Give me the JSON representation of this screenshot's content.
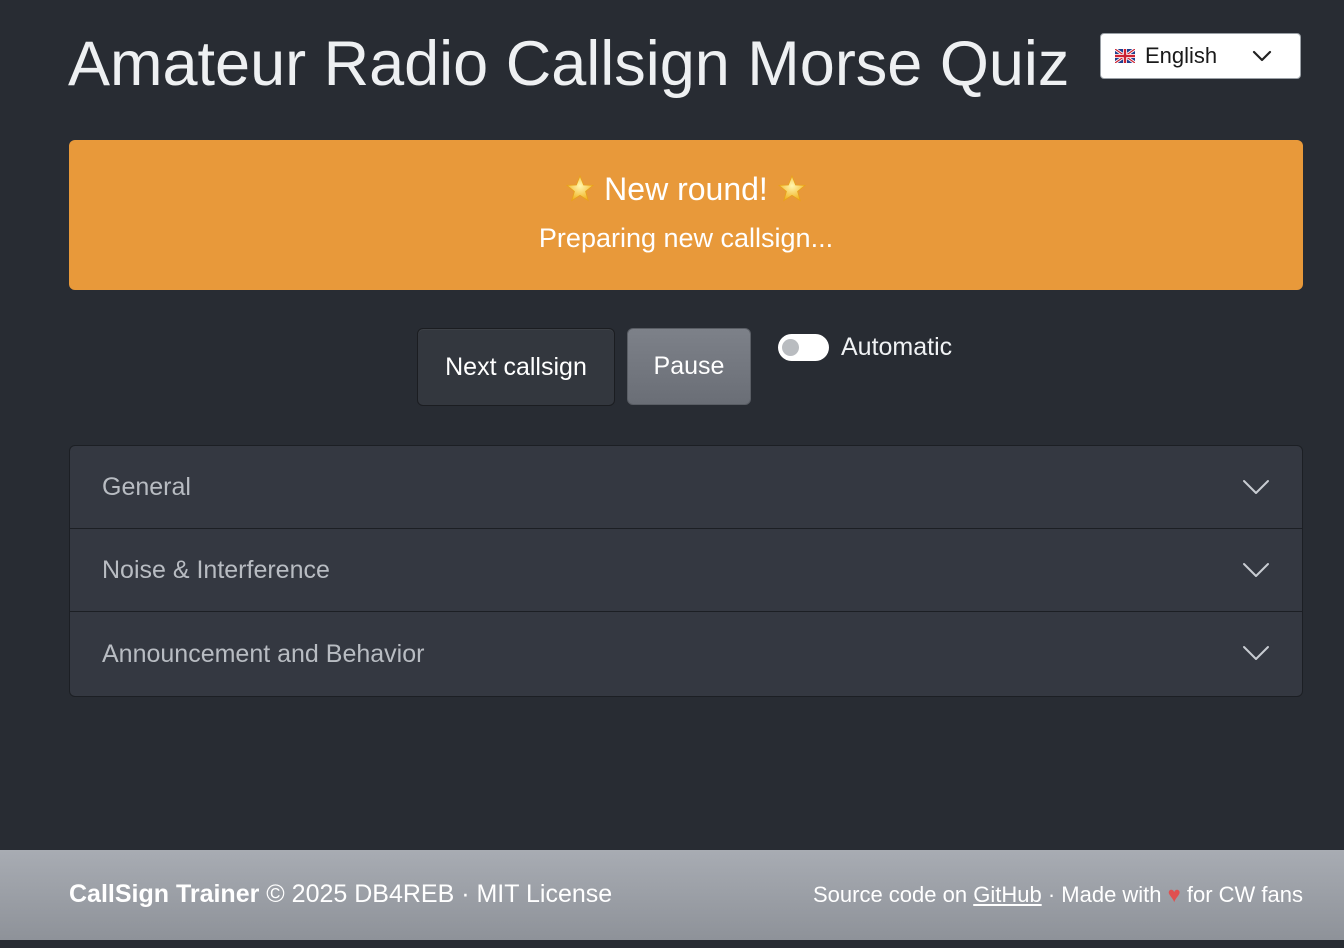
{
  "header": {
    "title": "Amateur Radio Callsign Morse Quiz",
    "language": {
      "flag_icon": "uk-flag-icon",
      "selected": "English"
    }
  },
  "banner": {
    "heading": "New round!",
    "star_icon": "star-icon",
    "subtext": "Preparing new callsign...",
    "color": "#e8993a"
  },
  "controls": {
    "next_label": "Next callsign",
    "pause_label": "Pause",
    "automatic_label": "Automatic",
    "automatic_on": false
  },
  "accordion": {
    "sections": [
      {
        "label": "General"
      },
      {
        "label": "Noise & Interference"
      },
      {
        "label": "Announcement and Behavior"
      }
    ]
  },
  "footer": {
    "app_name": "CallSign Trainer",
    "copyright": "© 2025 DB4REB · MIT License",
    "source_prefix": "Source code on",
    "source_link": "GitHub",
    "made_with_prefix": "· Made with",
    "heart": "♥",
    "made_with_suffix": "for CW fans"
  }
}
